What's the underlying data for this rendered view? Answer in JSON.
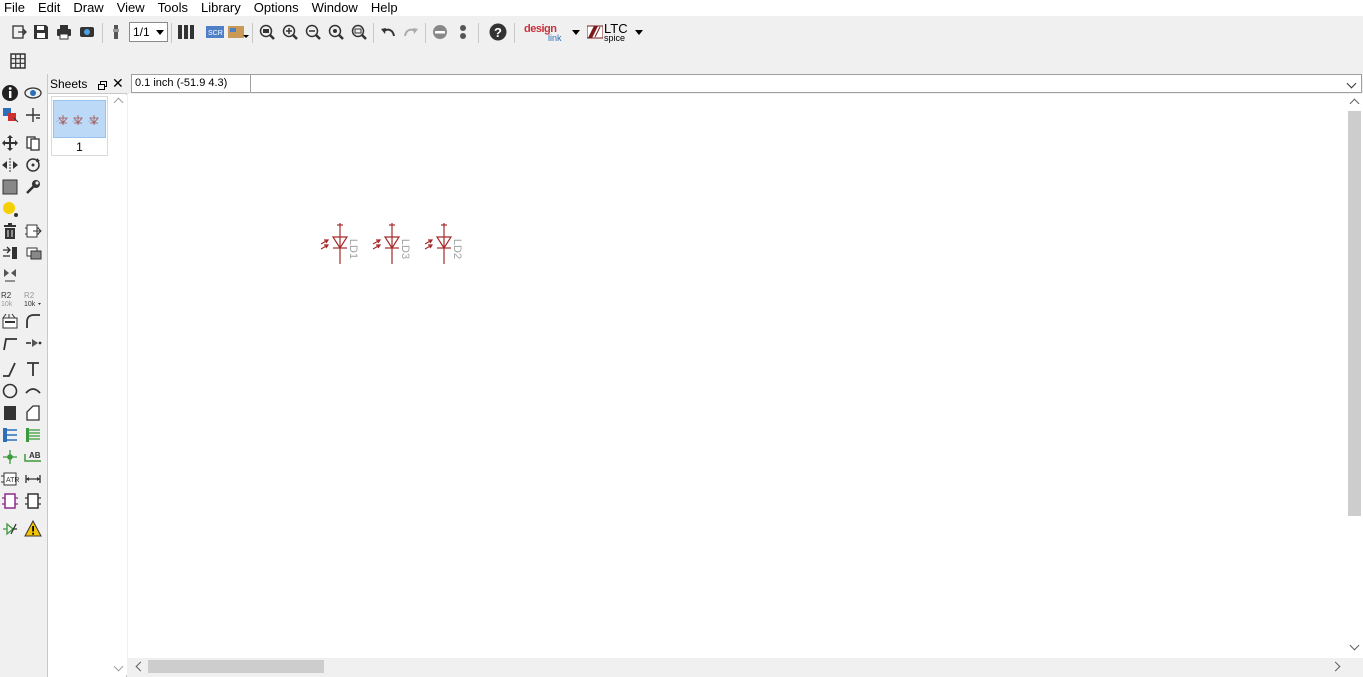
{
  "menu": {
    "items": [
      "File",
      "Edit",
      "Draw",
      "View",
      "Tools",
      "Library",
      "Options",
      "Window",
      "Help"
    ]
  },
  "toolbar": {
    "sheet_selector_value": "1/1",
    "icons": [
      "export-icon",
      "save-icon",
      "print-icon",
      "cam-icon",
      "sheet-select-icon",
      "schematic-board-icon",
      "scr-icon",
      "ulp-icon",
      "zoom-fit-icon",
      "zoom-in-icon",
      "zoom-out-icon",
      "zoom-redraw-icon",
      "zoom-area-icon",
      "undo-icon",
      "redo-icon",
      "stop-icon",
      "go-icon",
      "help-icon"
    ],
    "designlink_logo": {
      "line1": "design",
      "line2": "link"
    },
    "ltcspice_logo": {
      "line1": "LTC",
      "line2": "spice"
    }
  },
  "toolbar2": {
    "grid_icon": "grid-icon"
  },
  "palette": {
    "tools": [
      "info",
      "show",
      "display-layers",
      "mark",
      "move",
      "copy",
      "mirror",
      "rotate",
      "group",
      "change",
      "paste",
      "delete",
      "add",
      "replace",
      "invoke",
      "gateswap",
      "name",
      "value",
      "smash",
      "miter",
      "split",
      "pinswap",
      "wire",
      "text",
      "circle",
      "arc",
      "rectangle",
      "polygon",
      "bus",
      "net",
      "junction",
      "label",
      "attribute",
      "dimension",
      "frame",
      "module",
      "port",
      "erc"
    ]
  },
  "sheets": {
    "title": "Sheets",
    "items": [
      {
        "number": "1"
      }
    ]
  },
  "coord": {
    "readout": "0.1 inch (-51.9 4.3)",
    "command_value": "",
    "command_placeholder": ""
  },
  "schematic": {
    "parts": [
      {
        "name": "LD1"
      },
      {
        "name": "LD3"
      },
      {
        "name": "LD2"
      }
    ],
    "symbol_color": "#a52a2a",
    "label_color": "#a0a0a0"
  }
}
